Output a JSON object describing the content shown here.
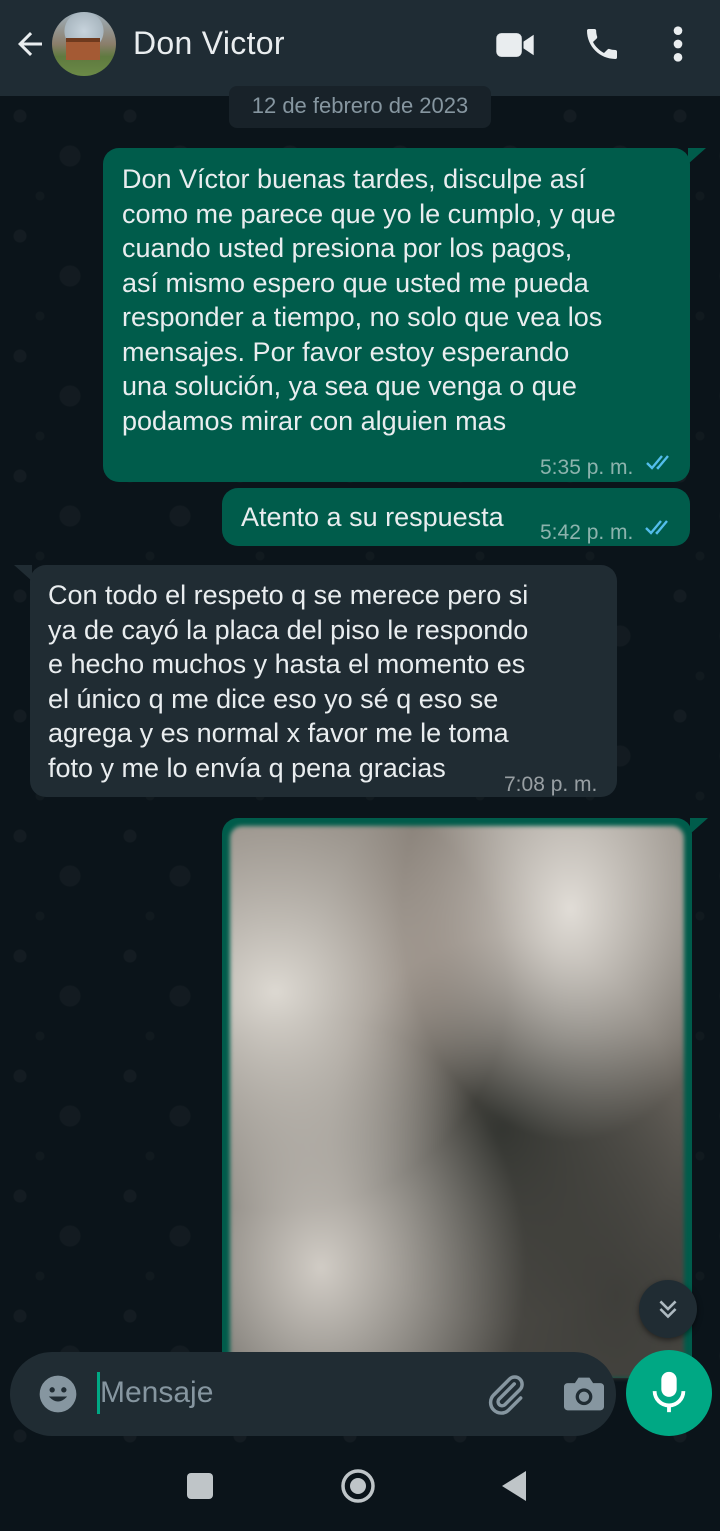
{
  "header": {
    "contact_name": "Don Victor",
    "back_icon": "arrow-left",
    "video_icon": "video-camera",
    "call_icon": "phone",
    "menu_icon": "more-vertical"
  },
  "date_chip": "12 de febrero de 2023",
  "messages": [
    {
      "direction": "outgoing",
      "text": "Don Víctor buenas tardes, disculpe así\ncomo me parece que yo le cumplo, y que\ncuando usted presiona por los pagos,\nasí mismo espero que usted me pueda\nresponder a tiempo, no solo que vea los\nmensajes. Por favor estoy esperando\nuna solución, ya sea que venga o que\npodamos mirar con alguien mas",
      "time": "5:35 p. m.",
      "status": "read"
    },
    {
      "direction": "outgoing",
      "text": "Atento a su respuesta",
      "time": "5:42 p. m.",
      "status": "read"
    },
    {
      "direction": "incoming",
      "text": "Con todo el respeto q se merece pero si\nya de cayó la placa del piso le respondo\ne hecho muchos y hasta el momento es\nel único q me dice eso yo sé q eso se\nagrega  y es normal x favor me le toma\nfoto y me lo envía q pena gracias",
      "time": "7:08 p. m."
    },
    {
      "direction": "outgoing",
      "type": "image",
      "content": "blurred photo"
    }
  ],
  "composer": {
    "placeholder": "Mensaje",
    "emoji_icon": "emoji",
    "attach_icon": "paperclip",
    "camera_icon": "camera",
    "mic_icon": "microphone"
  },
  "colors": {
    "header_bg": "#1f2c34",
    "chat_bg": "#0b141a",
    "outgoing_bubble": "#005c4b",
    "incoming_bubble": "#202c33",
    "accent": "#00a884",
    "read_ticks": "#53bdeb"
  }
}
